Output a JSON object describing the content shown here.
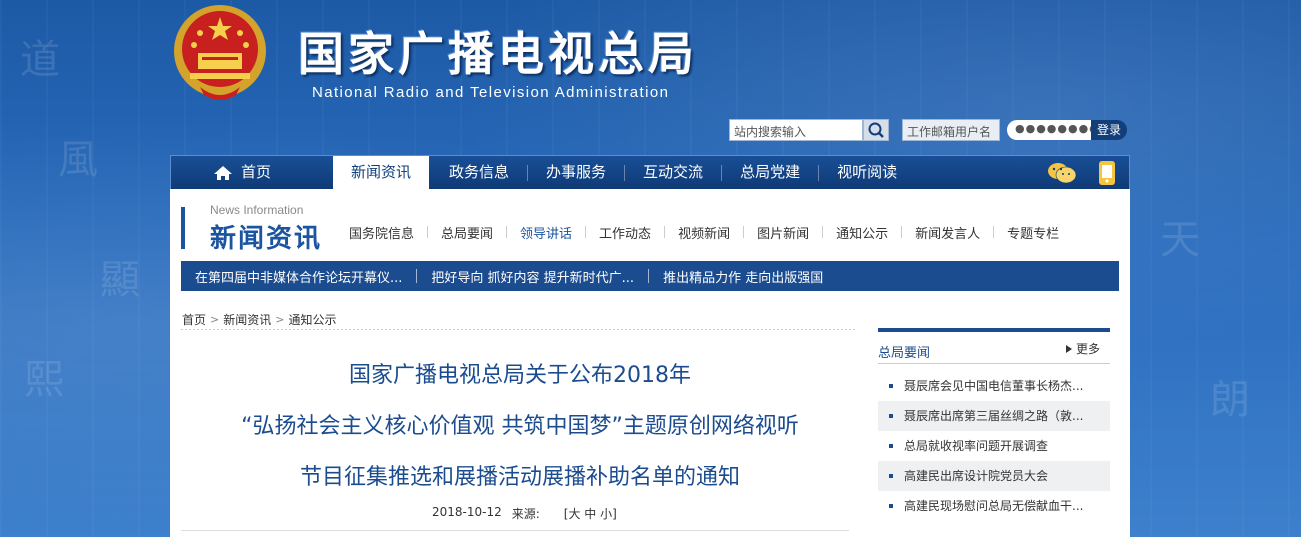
{
  "header": {
    "site_title": "国家广播电视总局",
    "site_subtitle": "National Radio and Television Administration"
  },
  "toolbar": {
    "search_placeholder": "站内搜索输入",
    "mail_user_placeholder": "工作邮箱用户名",
    "mail_password_value": "●●●●●●●●●",
    "login_label": "登录"
  },
  "main_nav": {
    "items": [
      {
        "label": "首页"
      },
      {
        "label": "新闻资讯",
        "active": true
      },
      {
        "label": "政务信息"
      },
      {
        "label": "办事服务"
      },
      {
        "label": "互动交流"
      },
      {
        "label": "总局党建"
      },
      {
        "label": "视听阅读"
      }
    ],
    "icons": [
      "wechat-icon",
      "mobile-icon"
    ]
  },
  "section": {
    "en": "News Information",
    "cn": "新闻资讯",
    "sub_nav": [
      {
        "label": "国务院信息"
      },
      {
        "label": "总局要闻"
      },
      {
        "label": "领导讲话",
        "active": true
      },
      {
        "label": "工作动态"
      },
      {
        "label": "视频新闻"
      },
      {
        "label": "图片新闻"
      },
      {
        "label": "通知公示"
      },
      {
        "label": "新闻发言人"
      },
      {
        "label": "专题专栏"
      }
    ]
  },
  "ticker": [
    "在第四届中非媒体合作论坛开幕仪...",
    "把好导向 抓好内容 提升新时代广...",
    "推出精品力作 走向出版强国"
  ],
  "breadcrumb": [
    "首页",
    "新闻资讯",
    "通知公示"
  ],
  "article": {
    "title_lines": [
      "国家广播电视总局关于公布2018年",
      "“弘扬社会主义核心价值观 共筑中国梦”主题原创网络视听",
      "节目征集推选和展播活动展播补助名单的通知"
    ],
    "date": "2018-10-12",
    "source_label": "来源:",
    "font_size_control": "[大 中 小]"
  },
  "sidebar": {
    "title": "总局要闻",
    "more": "更多",
    "items": [
      "聂辰席会见中国电信董事长杨杰...",
      "聂辰席出席第三届丝绸之路（敦...",
      "总局就收视率问题开展调查",
      "高建民出席设计院党员大会",
      "高建民现场慰问总局无偿献血干..."
    ]
  },
  "colors": {
    "brand_blue": "#1b4c8f",
    "nav_dark": "#0f3a76"
  }
}
